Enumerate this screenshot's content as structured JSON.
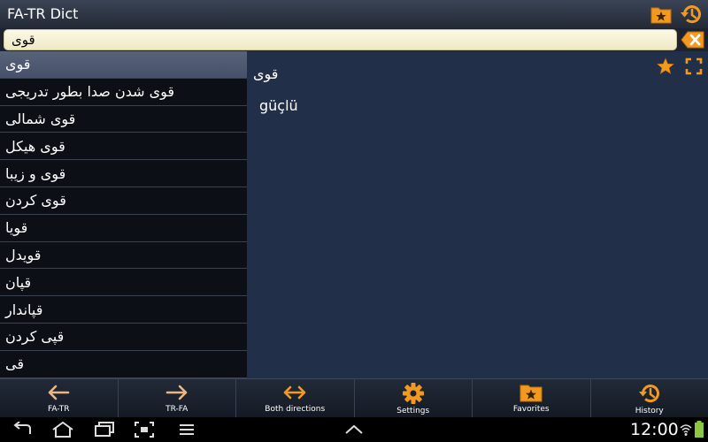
{
  "app": {
    "title": "FA-TR Dict"
  },
  "search": {
    "value": "قوی"
  },
  "word_list": [
    "قوی",
    "قوی شدن صدا بطور تدریجی",
    "قوی شمالی",
    "قوی هیکل",
    "قوی و زیبا",
    "قوی کردن",
    "قویا",
    "قویدل",
    "قپان",
    "قپاندار",
    "قپی کردن",
    "قی"
  ],
  "detail": {
    "word": "قوی",
    "translation": "güçlü"
  },
  "tabs": [
    {
      "label": "FA-TR",
      "icon": "arrow-left-icon"
    },
    {
      "label": "TR-FA",
      "icon": "arrow-right-icon"
    },
    {
      "label": "Both directions",
      "icon": "arrows-both-icon"
    },
    {
      "label": "Settings",
      "icon": "gear-icon"
    },
    {
      "label": "Favorites",
      "icon": "folder-star-icon"
    },
    {
      "label": "History",
      "icon": "history-icon"
    }
  ],
  "system": {
    "time": "12:00"
  },
  "colors": {
    "accent": "#f29a1f",
    "detail_bg": "#213048",
    "list_bg": "#0c0f16",
    "selected_row": "#505b72"
  }
}
